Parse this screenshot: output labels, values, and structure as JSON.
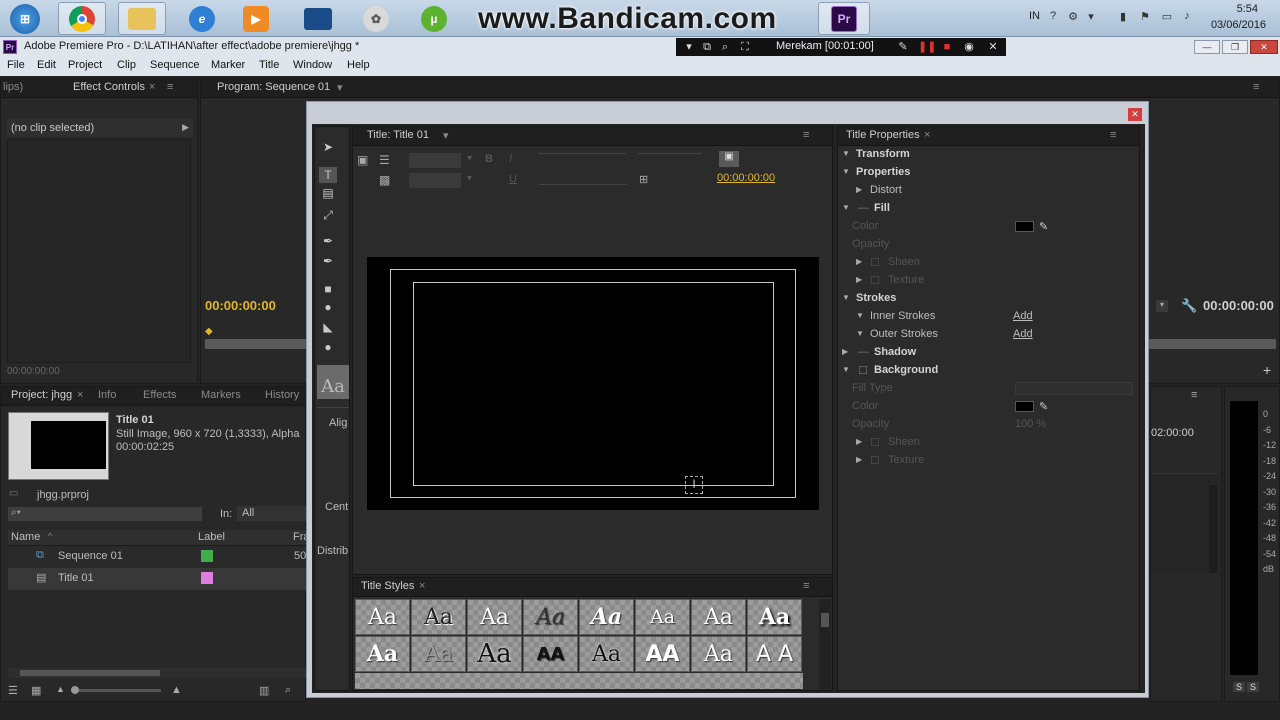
{
  "taskbar": {
    "watermark": "www.Bandicam.com",
    "language": "IN",
    "time": "5:54",
    "date": "03/06/2016",
    "icons": [
      "windows-start-icon",
      "chrome-icon",
      "folder-icon",
      "ie-icon",
      "media-player-icon",
      "window-icon",
      "tool-icon",
      "utorrent-icon",
      "premiere-icon"
    ],
    "premiere_label": "Pr"
  },
  "window": {
    "title": "Adobe Premiere Pro - D:\\LATIHAN\\after effect\\adobe premiere\\jhgg *",
    "app_badge": "Pr"
  },
  "bandicam": {
    "status": "Merekam [00:01:00]"
  },
  "menu": [
    "File",
    "Edit",
    "Project",
    "Clip",
    "Sequence",
    "Marker",
    "Title",
    "Window",
    "Help"
  ],
  "source_panel": {
    "tab_partial": "lips)",
    "effect_controls_tab": "Effect Controls",
    "no_clip": "(no clip selected)",
    "timecode": "00:00:00:00",
    "bottom_timecode": "00:00:00:00"
  },
  "program_panel": {
    "tab": "Program: Sequence 01",
    "timecode": "00:00:00:00"
  },
  "project_panel": {
    "tabs": [
      "Project: jhgg",
      "Info",
      "Effects",
      "Markers",
      "History"
    ],
    "clip_name": "Title 01",
    "clip_info_1": "Still Image, 960 x 720 (1,3333), Alpha",
    "clip_info_2": "00:00:02:25",
    "project_file": "jhgg.prproj",
    "in_label": "In:",
    "in_value": "All",
    "col_name": "Name",
    "col_label": "Label",
    "col_frame": "Fra",
    "rows": [
      {
        "name": "Sequence 01",
        "color": "#3fae4a",
        "extra": "50"
      },
      {
        "name": "Title 01",
        "color": "#e07de0",
        "extra": ""
      }
    ]
  },
  "timeline_panel": {
    "timecode": "02:00:00",
    "db_scale": [
      "0",
      "-6",
      "-12",
      "-18",
      "-24",
      "-30",
      "-36",
      "-42",
      "-48",
      "-54",
      "dB"
    ],
    "solo_labels": [
      "S",
      "S"
    ]
  },
  "title_designer": {
    "title_tab": "Title: Title 01",
    "timecode": "00:00:00:00",
    "align_label": "Alig",
    "center_label": "Cent",
    "distribute_label": "Distrib",
    "tool_sample": "Aa",
    "styles_tab": "Title Styles",
    "styles_row1": [
      "Aa",
      "Aa",
      "Aa",
      "Aa",
      "Aa",
      "Aa",
      "Aa",
      "Aa"
    ],
    "styles_row2": [
      "Aa",
      "Aa",
      "Aa",
      "AA",
      "Aa",
      "AA",
      "Aa",
      "A A"
    ],
    "properties_tab": "Title Properties",
    "properties": {
      "transform": "Transform",
      "properties": "Properties",
      "distort": "Distort",
      "fill": "Fill",
      "color": "Color",
      "opacity": "Opacity",
      "sheen": "Sheen",
      "texture": "Texture",
      "strokes": "Strokes",
      "inner_strokes": "Inner Strokes",
      "outer_strokes": "Outer Strokes",
      "add": "Add",
      "shadow": "Shadow",
      "background": "Background",
      "fill_type": "Fill Type",
      "bg_color": "Color",
      "bg_opacity": "Opacity",
      "bg_opacity_value": "100 %",
      "bg_sheen": "Sheen",
      "bg_texture": "Texture"
    }
  }
}
